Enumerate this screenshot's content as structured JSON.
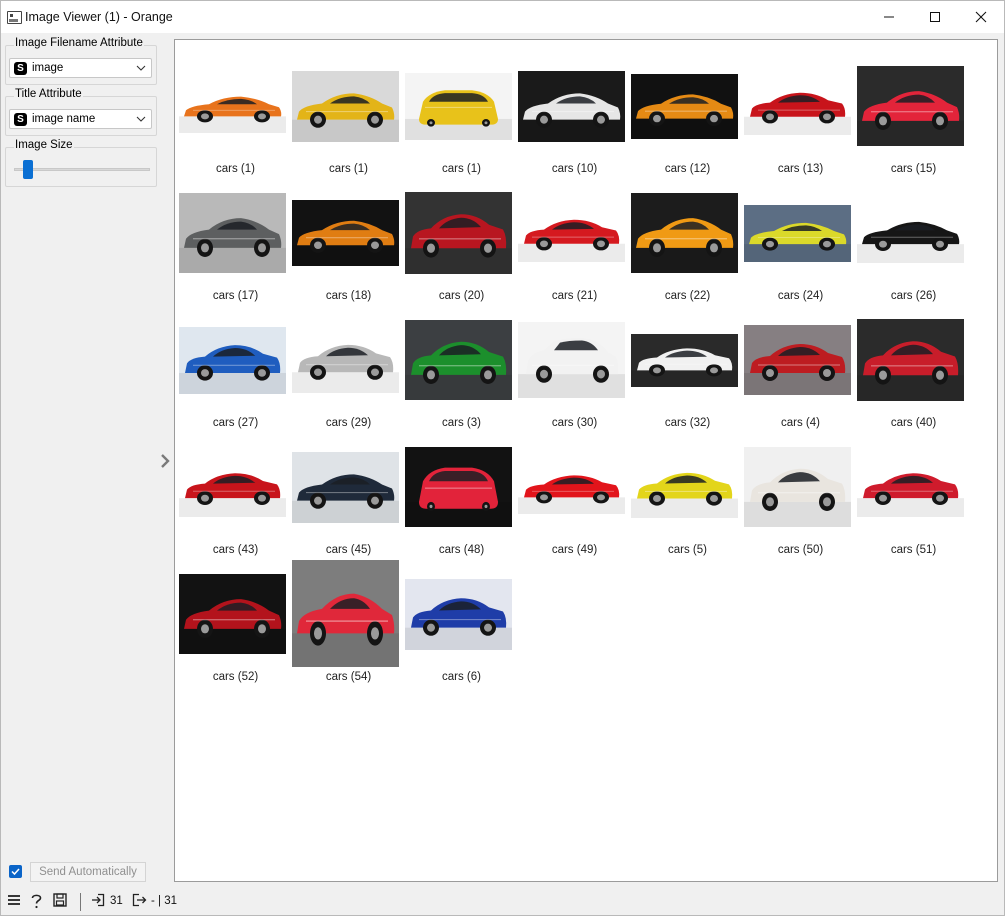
{
  "window": {
    "title": "Image Viewer (1) - Orange"
  },
  "controls": {
    "filename_attr": {
      "label": "Image Filename Attribute",
      "type_icon": "S",
      "value": "image"
    },
    "title_attr": {
      "label": "Title Attribute",
      "type_icon": "S",
      "value": "image name"
    },
    "image_size": {
      "label": "Image Size",
      "level": 0.05
    }
  },
  "send": {
    "label": "Send Automatically",
    "checked": true
  },
  "status": {
    "input_count": "31",
    "output_text": "- | 31"
  },
  "images": [
    {
      "title": "cars (1)",
      "bg": "#ffffff",
      "body": "#e8731c",
      "shape": "super"
    },
    {
      "title": "cars (1)",
      "bg": "#d9d9d9",
      "body": "#e3b418",
      "shape": "super"
    },
    {
      "title": "cars (1)",
      "bg": "#f4f4f4",
      "body": "#e8c21a",
      "shape": "front"
    },
    {
      "title": "cars (10)",
      "bg": "#1a1a1a",
      "body": "#e6e6e6",
      "shape": "super"
    },
    {
      "title": "cars (12)",
      "bg": "#111111",
      "body": "#e58a14",
      "shape": "super"
    },
    {
      "title": "cars (13)",
      "bg": "#ffffff",
      "body": "#c8141b",
      "shape": "coupe"
    },
    {
      "title": "cars (15)",
      "bg": "#2b2b2b",
      "body": "#e3243a",
      "shape": "super"
    },
    {
      "title": "cars (17)",
      "bg": "#b9b9b9",
      "body": "#5d5f60",
      "shape": "super"
    },
    {
      "title": "cars (18)",
      "bg": "#121212",
      "body": "#e07d12",
      "shape": "super"
    },
    {
      "title": "cars (20)",
      "bg": "#333333",
      "body": "#b81620",
      "shape": "coupe"
    },
    {
      "title": "cars (21)",
      "bg": "#ffffff",
      "body": "#d5191f",
      "shape": "coupe"
    },
    {
      "title": "cars (22)",
      "bg": "#1c1c1c",
      "body": "#f09a14",
      "shape": "super"
    },
    {
      "title": "cars (24)",
      "bg": "#5c6e84",
      "body": "#dbd92a",
      "shape": "super"
    },
    {
      "title": "cars (26)",
      "bg": "#ffffff",
      "body": "#161616",
      "shape": "super"
    },
    {
      "title": "cars (27)",
      "bg": "#dfe7ef",
      "body": "#1f5dbf",
      "shape": "coupe"
    },
    {
      "title": "cars (29)",
      "bg": "#ffffff",
      "body": "#b8b8b8",
      "shape": "coupe"
    },
    {
      "title": "cars (3)",
      "bg": "#3c3f42",
      "body": "#1c8f2c",
      "shape": "coupe"
    },
    {
      "title": "cars (30)",
      "bg": "#f4f4f4",
      "body": "#f2f2f2",
      "shape": "suv"
    },
    {
      "title": "cars (32)",
      "bg": "#2a2a2a",
      "body": "#f1f1f1",
      "shape": "coupe"
    },
    {
      "title": "cars (4)",
      "bg": "#867f82",
      "body": "#bd1c21",
      "shape": "coupe"
    },
    {
      "title": "cars (40)",
      "bg": "#2b2b2b",
      "body": "#c81d2a",
      "shape": "coupe"
    },
    {
      "title": "cars (43)",
      "bg": "#ffffff",
      "body": "#c8141b",
      "shape": "coupe"
    },
    {
      "title": "cars (45)",
      "bg": "#dfe3e7",
      "body": "#1f2a3a",
      "shape": "super"
    },
    {
      "title": "cars (48)",
      "bg": "#121212",
      "body": "#e2233a",
      "shape": "front"
    },
    {
      "title": "cars (49)",
      "bg": "#ffffff",
      "body": "#e2141b",
      "shape": "coupe"
    },
    {
      "title": "cars (5)",
      "bg": "#ffffff",
      "body": "#e3d51a",
      "shape": "coupe"
    },
    {
      "title": "cars (50)",
      "bg": "#f0f0f0",
      "body": "#e9e5df",
      "shape": "coupe"
    },
    {
      "title": "cars (51)",
      "bg": "#ffffff",
      "body": "#cf1b2c",
      "shape": "coupe"
    },
    {
      "title": "cars (52)",
      "bg": "#121212",
      "body": "#b3131c",
      "shape": "super"
    },
    {
      "title": "cars (54)",
      "bg": "#7d7d7d",
      "body": "#e0283a",
      "shape": "super"
    },
    {
      "title": "cars (6)",
      "bg": "#e3e6ef",
      "body": "#1f3da8",
      "shape": "coupe"
    }
  ]
}
